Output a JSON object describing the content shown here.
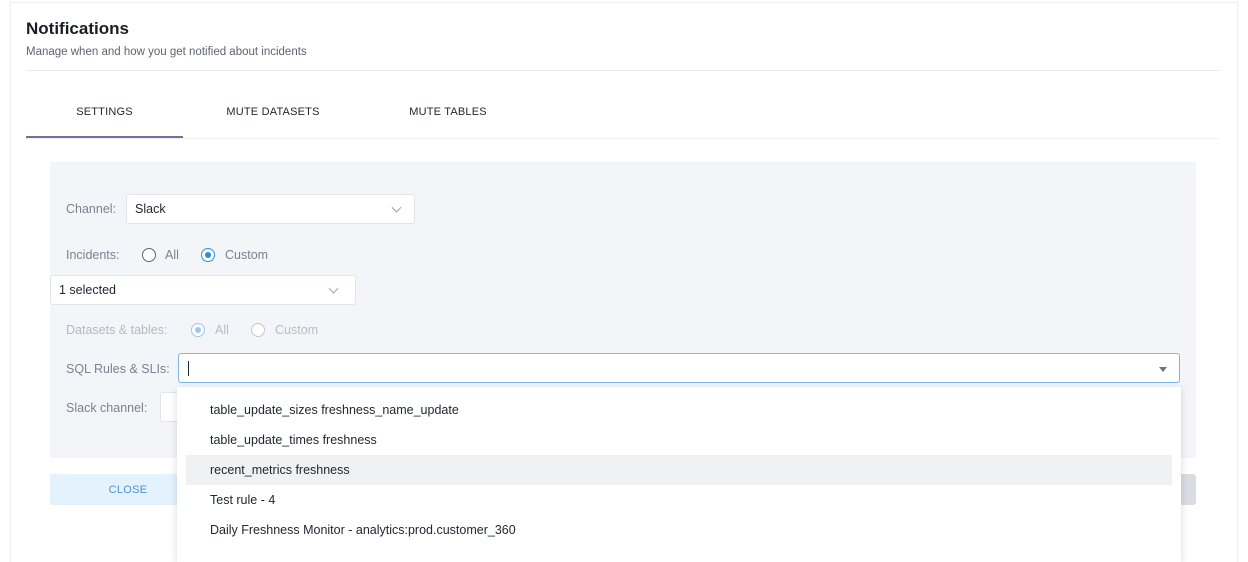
{
  "header": {
    "title": "Notifications",
    "subtitle": "Manage when and how you get notified about incidents"
  },
  "tabs": [
    {
      "label": "SETTINGS",
      "active": true
    },
    {
      "label": "MUTE DATASETS",
      "active": false
    },
    {
      "label": "MUTE TABLES",
      "active": false
    }
  ],
  "form": {
    "channel": {
      "label": "Channel:",
      "value": "Slack"
    },
    "incidents": {
      "label": "Incidents:",
      "options": [
        "All",
        "Custom"
      ],
      "selected": "Custom"
    },
    "incident_types": {
      "value": "1 selected"
    },
    "datasets_tables": {
      "label": "Datasets & tables:",
      "options": [
        "All",
        "Custom"
      ],
      "selected": "All",
      "disabled": true
    },
    "sql_rules": {
      "label": "SQL Rules & SLIs:",
      "value": ""
    },
    "slack_channel": {
      "label": "Slack channel:"
    }
  },
  "dropdown": {
    "options": [
      "table_update_sizes freshness_name_update",
      "table_update_times freshness",
      "recent_metrics freshness",
      "Test rule - 4",
      "Daily Freshness Monitor - analytics:prod.customer_360"
    ],
    "highlighted_index": 2
  },
  "footer": {
    "close_label": "CLOSE"
  },
  "colors": {
    "accent": "#2b8be0",
    "tab_indicator": "#7a6d95",
    "form_bg": "#f3f5f9",
    "close_bg": "#e4f2fd"
  }
}
